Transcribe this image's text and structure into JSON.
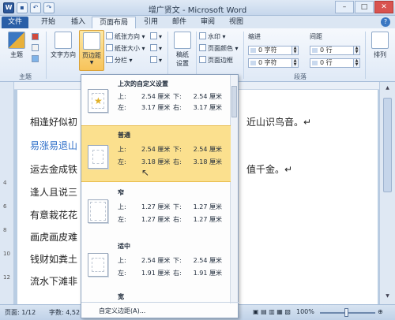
{
  "window": {
    "title": "增广贤文 - Microsoft Word"
  },
  "qat": {
    "word_icon": "W"
  },
  "tabs": [
    {
      "label": "文件"
    },
    {
      "label": "开始"
    },
    {
      "label": "插入"
    },
    {
      "label": "页面布局"
    },
    {
      "label": "引用"
    },
    {
      "label": "邮件"
    },
    {
      "label": "审阅"
    },
    {
      "label": "视图"
    }
  ],
  "ribbon": {
    "theme_label": "主题",
    "theme_group": "主题",
    "text_direction": "文字方向",
    "margins": "页边距",
    "orientation": "纸张方向",
    "size": "纸张大小",
    "columns": "分栏",
    "manuscript_line1": "稿纸",
    "manuscript_line2": "设置",
    "watermark": "水印",
    "page_color": "页面颜色",
    "page_border": "页面边框",
    "indent_label": "缩进",
    "spacing_label": "间距",
    "indent_left": "0 字符",
    "indent_right": "0 字符",
    "spacing_before": "0 行",
    "spacing_after": "0 行",
    "paragraph_group": "段落",
    "arrange": "排列"
  },
  "document": {
    "lines": [
      "相逢好似初",
      "易涨易退山",
      "运去金成铁",
      "逢人且说三",
      "有意栽花花",
      "画虎画皮难",
      "钱财如粪土",
      "流水下滩非"
    ],
    "line_ends": [
      "近山识鸟音。↵",
      "值千金。↵"
    ],
    "ruler_numbers": [
      "4",
      "6",
      "8",
      "10",
      "12"
    ]
  },
  "margins_menu": {
    "presets": [
      {
        "name": "上次的自定义设置",
        "top_label": "上:",
        "top": "2.54 厘米",
        "bottom_label": "下:",
        "bottom": "2.54 厘米",
        "left_label": "左:",
        "left": "3.17 厘米",
        "right_label": "右:",
        "right": "3.17 厘米"
      },
      {
        "name": "普通",
        "top_label": "上:",
        "top": "2.54 厘米",
        "bottom_label": "下:",
        "bottom": "2.54 厘米",
        "left_label": "左:",
        "left": "3.18 厘米",
        "right_label": "右:",
        "right": "3.18 厘米"
      },
      {
        "name": "窄",
        "top_label": "上:",
        "top": "1.27 厘米",
        "bottom_label": "下:",
        "bottom": "1.27 厘米",
        "left_label": "左:",
        "left": "1.27 厘米",
        "right_label": "右:",
        "right": "1.27 厘米"
      },
      {
        "name": "适中",
        "top_label": "上:",
        "top": "2.54 厘米",
        "bottom_label": "下:",
        "bottom": "2.54 厘米",
        "left_label": "左:",
        "left": "1.91 厘米",
        "right_label": "右:",
        "right": "1.91 厘米"
      },
      {
        "name": "宽"
      }
    ],
    "custom": "自定义边距(A)..."
  },
  "status": {
    "page": "页面: 1/12",
    "words": "字数: 4,52",
    "zoom": "100%"
  },
  "colors": {
    "accent": "#2b579a",
    "highlight": "#fbe08e",
    "link": "#2f6fc9"
  }
}
